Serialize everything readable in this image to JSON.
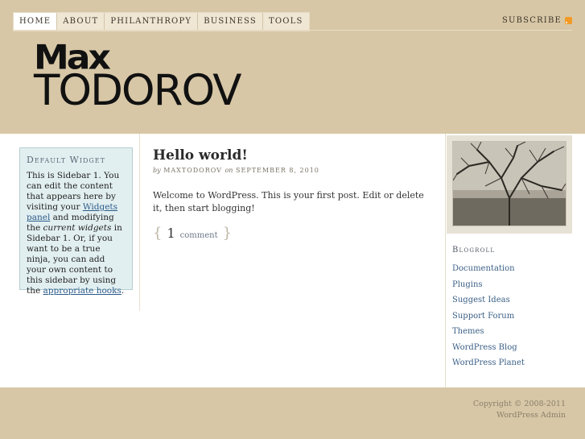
{
  "nav": {
    "items": [
      "HOME",
      "ABOUT",
      "PHILANTHROPY",
      "BUSINESS",
      "TOOLS"
    ],
    "subscribe": "SUBSCRIBE"
  },
  "logo": {
    "top": "Max",
    "bottom": "TODOROV"
  },
  "widget": {
    "title": "Default Widget",
    "text1": "This is Sidebar 1. You can edit the content that appears here by visiting your ",
    "link1": "Widgets panel",
    "text2": " and modifying the ",
    "em": "current widgets",
    "text3": " in Sidebar 1. Or, if you want to be a true ninja, you can add your own content to this sidebar by using the ",
    "link2": "appropriate hooks",
    "text4": "."
  },
  "post": {
    "title": "Hello world!",
    "meta_by": "by",
    "author": "MAXTODOROV",
    "meta_on": "on",
    "date": "SEPTEMBER 8, 2010",
    "body": "Welcome to WordPress. This is your first post. Edit or delete it, then start blogging!",
    "comment_count": "1",
    "comment_word": "comment",
    "brace_open": "{",
    "brace_close": "}"
  },
  "blogroll": {
    "title": "Blogroll",
    "items": [
      "Documentation",
      "Plugins",
      "Suggest Ideas",
      "Support Forum",
      "Themes",
      "WordPress Blog",
      "WordPress Planet"
    ]
  },
  "footer": {
    "copyright": "Copyright © 2008-2011",
    "admin": "WordPress Admin"
  },
  "colors": {
    "header_bg": "#d7c7a6",
    "widget_bg": "#e2eff0",
    "link": "#3a5f86"
  }
}
